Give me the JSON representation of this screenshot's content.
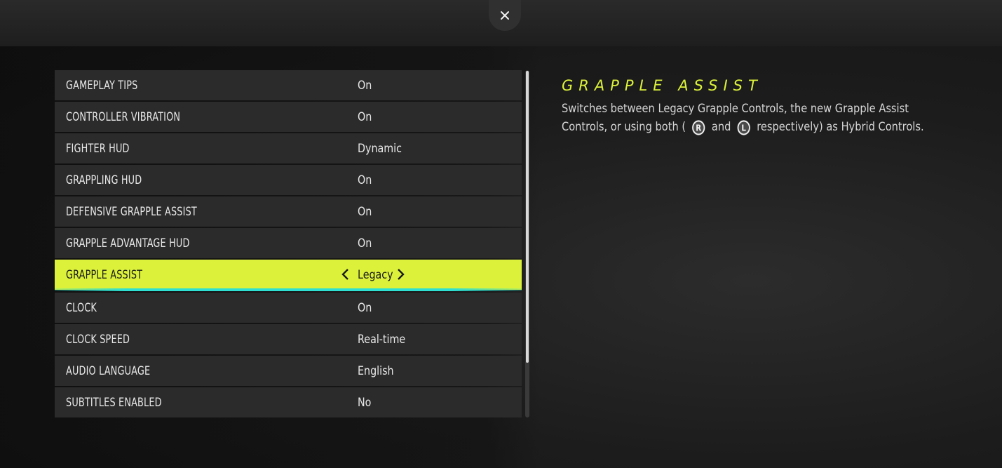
{
  "close_icon": "close-icon",
  "settings": [
    {
      "label": "GAMEPLAY TIPS",
      "value": "On"
    },
    {
      "label": "CONTROLLER VIBRATION",
      "value": "On"
    },
    {
      "label": "FIGHTER HUD",
      "value": "Dynamic"
    },
    {
      "label": "GRAPPLING HUD",
      "value": "On"
    },
    {
      "label": "DEFENSIVE GRAPPLE ASSIST",
      "value": "On"
    },
    {
      "label": "GRAPPLE ADVANTAGE HUD",
      "value": "On"
    },
    {
      "label": "GRAPPLE ASSIST",
      "value": "Legacy"
    },
    {
      "label": "CLOCK",
      "value": "On"
    },
    {
      "label": "CLOCK SPEED",
      "value": "Real-time"
    },
    {
      "label": "AUDIO LANGUAGE",
      "value": "English"
    },
    {
      "label": "SUBTITLES ENABLED",
      "value": "No"
    }
  ],
  "selected_index": 6,
  "description": {
    "title": "GRAPPLE ASSIST",
    "line1": "Switches between Legacy Grapple Controls, the new Grapple Assist",
    "line2_part1": "Controls, or using both (",
    "icon_right_stick_letter": "R",
    "line2_part2": "and",
    "icon_left_stick_letter": "L",
    "line2_part3": "respectively) as Hybrid Controls."
  },
  "colors": {
    "accent": "#dcf23a",
    "highlight_underline": "#2fe0d2",
    "row_background": "#2b2b2b"
  }
}
